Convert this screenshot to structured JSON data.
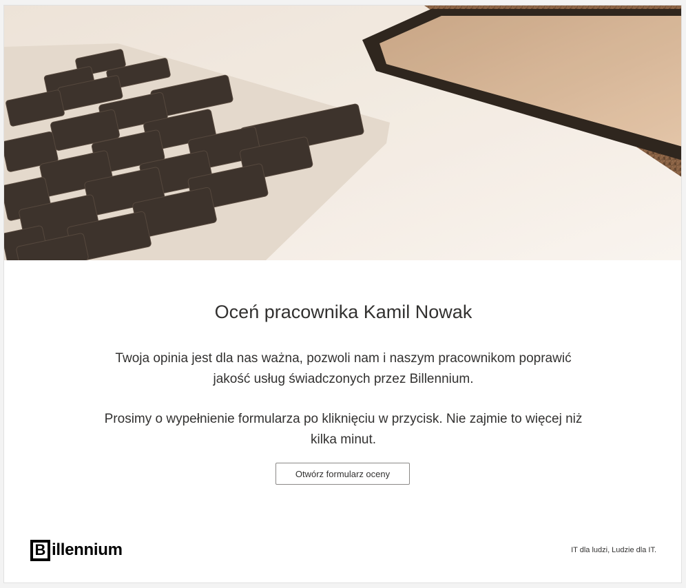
{
  "hero": {
    "image_description_icon": "laptop-keyboard-numpad-photo"
  },
  "content": {
    "title": "Oceń pracownika Kamil Nowak",
    "paragraph1": "Twoja opinia jest dla nas ważna, pozwoli nam i naszym pracownikom poprawić jakość usług świadczonych przez Billennium.",
    "paragraph2": "Prosimy o wypełnienie formularza po kliknięciu w przycisk. Nie zajmie to więcej niż kilka minut.",
    "button_label": "Otwórz formularz oceny"
  },
  "footer": {
    "logo_letter": "B",
    "logo_rest": "illennium",
    "tagline": "IT dla ludzi, Ludzie dla IT."
  },
  "colors": {
    "text": "#323130",
    "button_border": "#8a8886",
    "background": "#ffffff",
    "page_background": "#f3f3f3"
  }
}
